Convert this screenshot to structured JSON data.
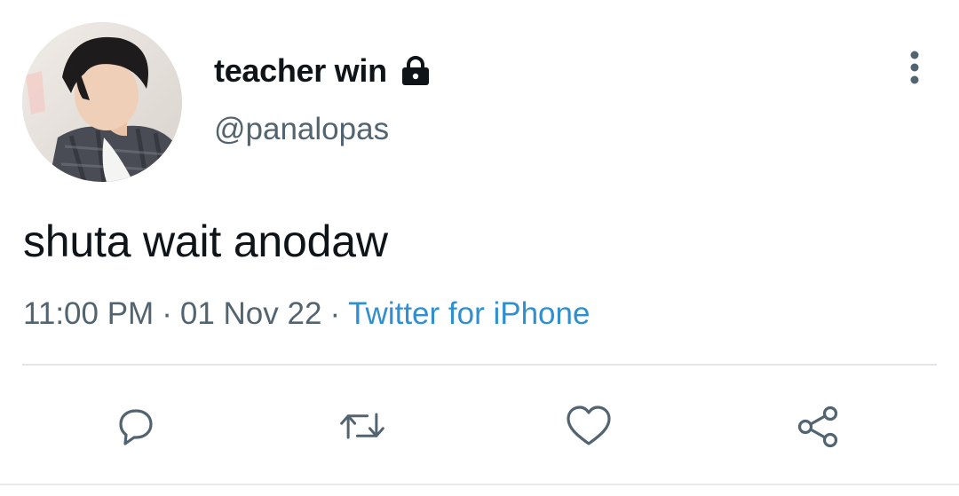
{
  "author": {
    "display_name": "teacher win",
    "handle": "@panalopas",
    "protected_icon": "lock-icon",
    "avatar": "profile-photo"
  },
  "tweet": {
    "text": "shuta wait anodaw",
    "time": "11:00 PM",
    "separator": "·",
    "date": "01 Nov 22",
    "source": "Twitter for iPhone"
  },
  "actions": [
    {
      "name": "reply",
      "icon": "comment-bubble-icon"
    },
    {
      "name": "retweet",
      "icon": "retweet-arrows-icon"
    },
    {
      "name": "like",
      "icon": "heart-icon"
    },
    {
      "name": "share",
      "icon": "share-icon"
    }
  ],
  "colors": {
    "text": "#0f1419",
    "secondary": "#536471",
    "link": "#2f8fd0",
    "divider": "#e3e6e9",
    "icon": "#536471"
  }
}
